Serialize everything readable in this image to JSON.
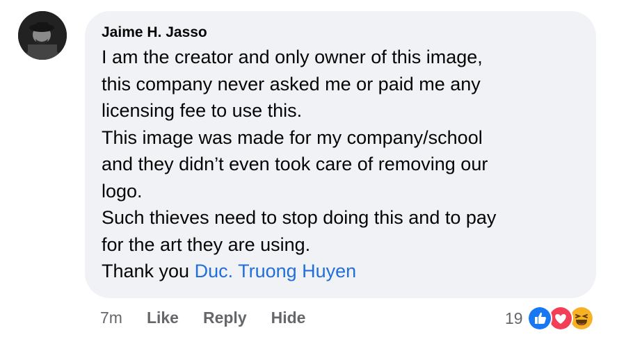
{
  "comment": {
    "author": "Jaime H. Jasso",
    "lines": [
      "I am the creator and only owner of this image,",
      "this company never asked me or paid me any",
      "licensing fee to use this.",
      "This image was made for my company/school",
      "and they didn’t even took care of removing our",
      "logo.",
      "Such thieves need to stop doing this and to pay",
      "for the art they are using."
    ],
    "closing_text": "Thank you ",
    "mention": "Duc. Truong Huyen",
    "mention_color": "#216fdb"
  },
  "actions": {
    "time": "7m",
    "like": "Like",
    "reply": "Reply",
    "hide": "Hide"
  },
  "reactions": {
    "count": "19",
    "icons": [
      "like-icon",
      "love-icon",
      "haha-icon"
    ],
    "like_color": "#1877f2",
    "love_color": "#f33e58",
    "haha_color": "#f7b125"
  }
}
